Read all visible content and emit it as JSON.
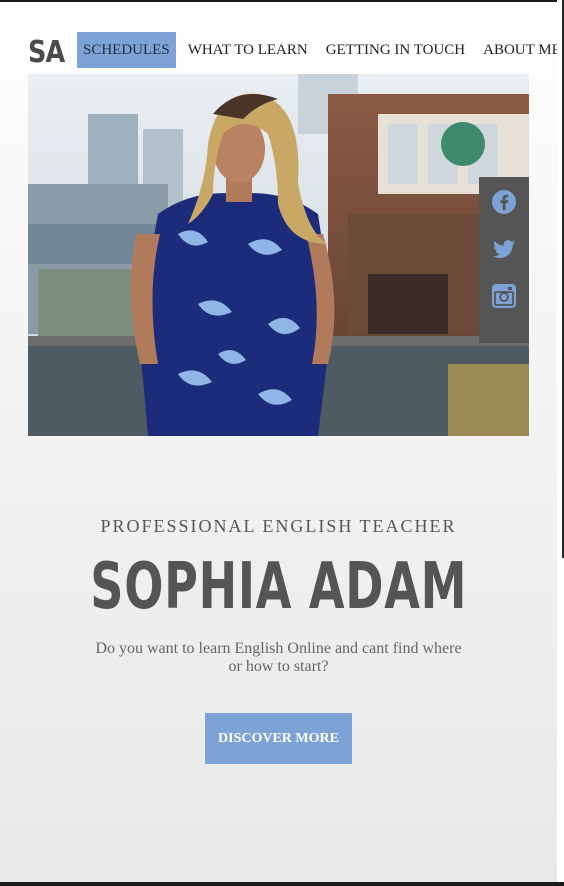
{
  "logo": "SA",
  "nav": {
    "items": [
      {
        "label": "SCHEDULES",
        "active": true
      },
      {
        "label": "WHAT TO LEARN",
        "active": false
      },
      {
        "label": "GETTING IN TOUCH",
        "active": false
      },
      {
        "label": "ABOUT ME",
        "active": false
      }
    ]
  },
  "social": {
    "icons": [
      "facebook-icon",
      "twitter-icon",
      "instagram-icon"
    ]
  },
  "hero": {
    "kicker": "PROFESSIONAL ENGLISH TEACHER",
    "name": "SOPHIA ADAM",
    "tagline": "Do you want to learn English Online and cant find where or how to start?",
    "cta": "DISCOVER MORE"
  },
  "colors": {
    "accent": "#7da3d6",
    "text": "#555555",
    "social_bg": "#555555"
  }
}
